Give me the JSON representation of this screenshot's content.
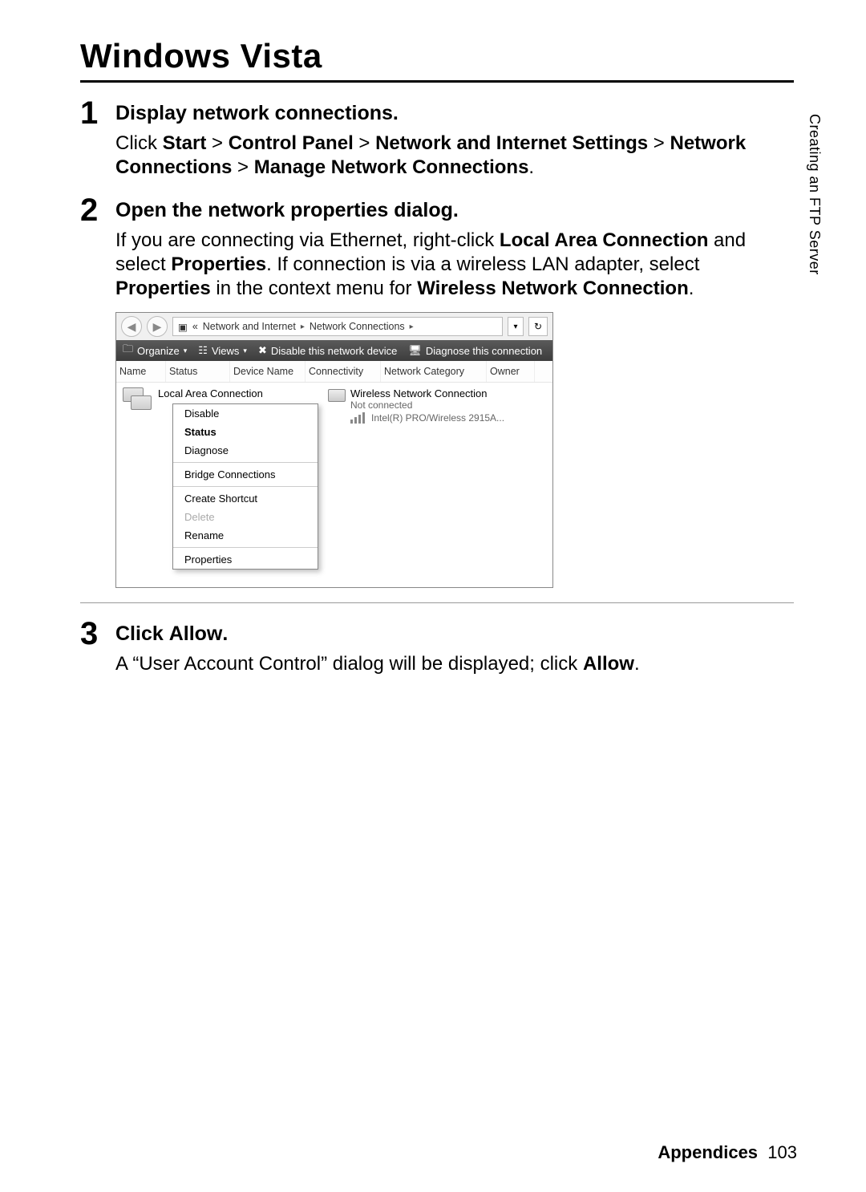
{
  "sideTab": "Creating an FTP Server",
  "sectionTitle": "Windows Vista",
  "steps": [
    {
      "n": "1",
      "title": "Display network connections.",
      "desc_html": "Click <b>Start</b> > <b>Control Panel</b> > <b>Network and Internet Settings</b> > <b>Network Connections</b> > <b>Manage Network Connections</b>."
    },
    {
      "n": "2",
      "title": "Open the network properties dialog.",
      "desc_html": "If you are connecting via Ethernet, right-click <b>Local Area Connection</b> and select <b>Properties</b>. If connection is via a wireless LAN adapter, select <b>Properties</b> in the context menu for <b>Wireless Network Connection</b>."
    },
    {
      "n": "3",
      "title_html": "Click <b>Allow</b>.",
      "desc_html": "A “User Account Control” dialog will be displayed; click <b>Allow</b>."
    }
  ],
  "screenshot": {
    "breadcrumb": {
      "chev": "«",
      "p1": "Network and Internet",
      "sep": "▸",
      "p2": "Network Connections",
      "sepEnd": "▸"
    },
    "toolbar": {
      "organize": "Organize",
      "views": "Views",
      "disable": "Disable this network device",
      "diagnose": "Diagnose this connection"
    },
    "cols": [
      "Name",
      "Status",
      "Device Name",
      "Connectivity",
      "Network Category",
      "Owner"
    ],
    "localConn": "Local Area Connection",
    "contextMenu": [
      "Disable",
      "Status",
      "Diagnose",
      "Bridge Connections",
      "Create Shortcut",
      "Delete",
      "Rename",
      "Properties"
    ],
    "wireless": {
      "title": "Wireless Network Connection",
      "status": "Not connected",
      "device": "Intel(R) PRO/Wireless 2915A..."
    }
  },
  "footer": {
    "section": "Appendices",
    "page": "103"
  }
}
